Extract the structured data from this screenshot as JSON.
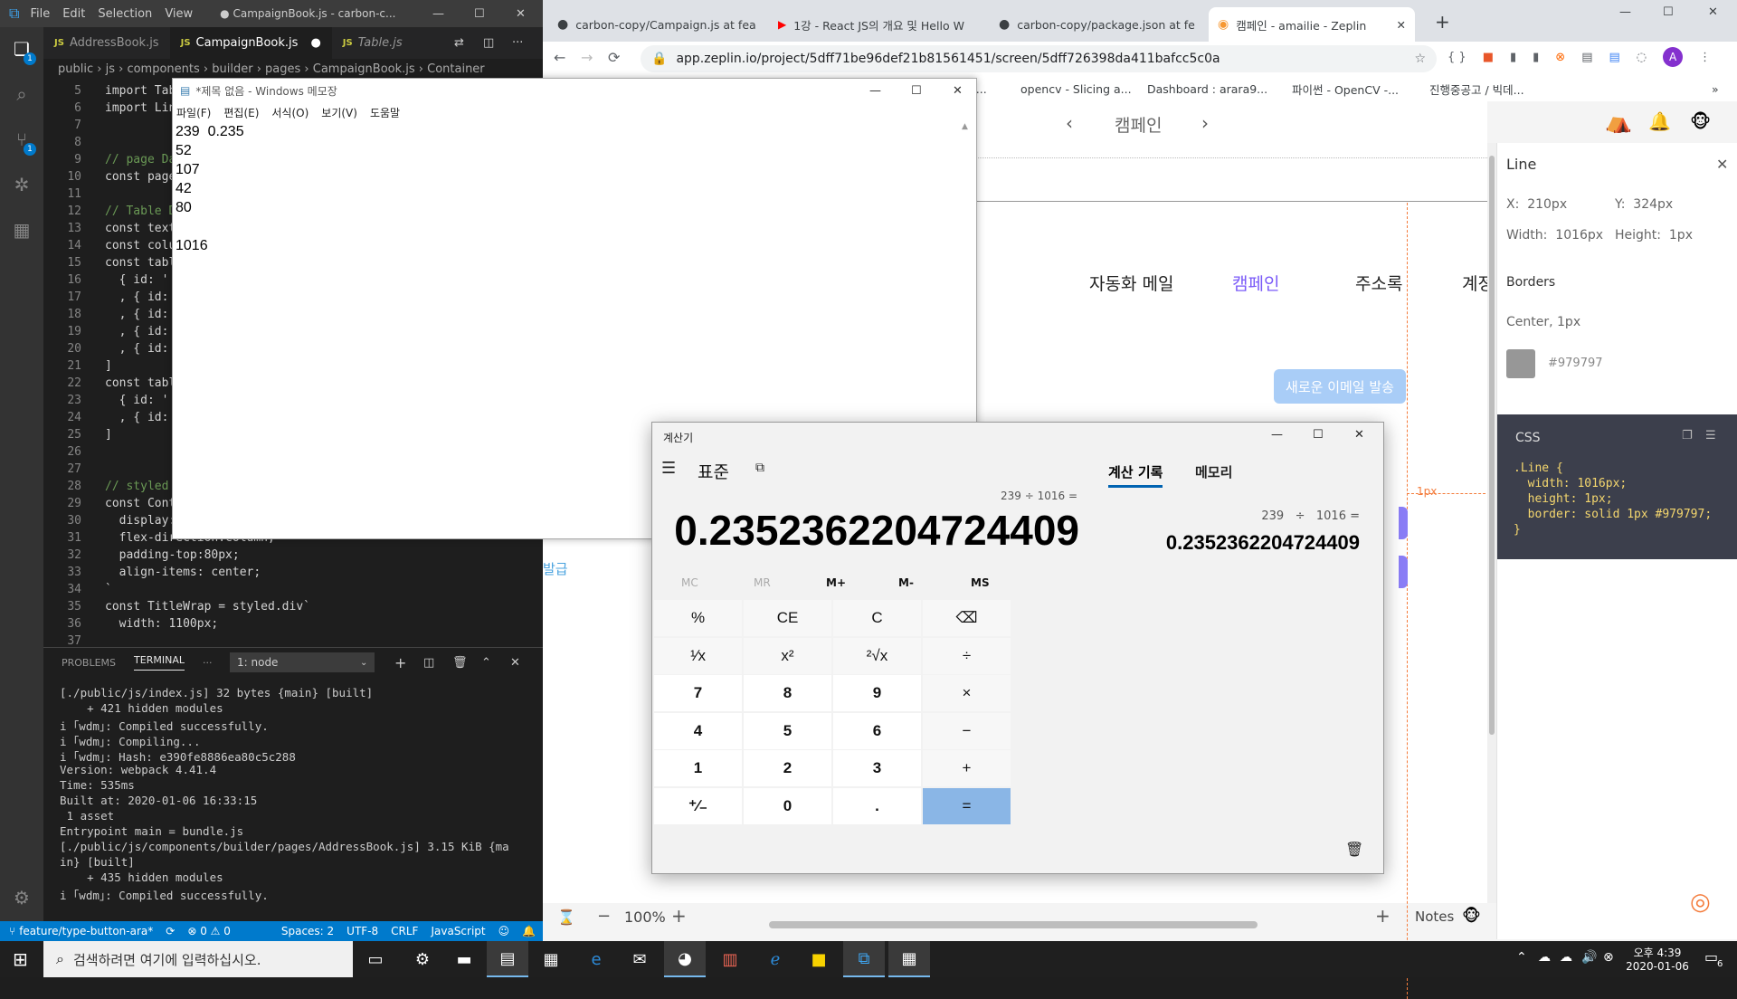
{
  "vscode": {
    "menu": [
      "File",
      "Edit",
      "Selection",
      "View"
    ],
    "title": "● CampaignBook.js - carbon-c...",
    "tabs": [
      {
        "label": "AddressBook.js",
        "badge": "JS",
        "italic": false,
        "active": false
      },
      {
        "label": "CampaignBook.js",
        "badge": "JS",
        "italic": false,
        "active": true,
        "dirty": "●"
      },
      {
        "label": "Table.js",
        "badge": "JS",
        "italic": true,
        "active": false
      }
    ],
    "breadcrumb": [
      "public",
      "js",
      "components",
      "builder",
      "pages",
      "CampaignBook.js",
      "Container"
    ],
    "lines": [
      {
        "n": "5",
        "t": "import Tab"
      },
      {
        "n": "6",
        "t": "import Lin"
      },
      {
        "n": "7",
        "t": ""
      },
      {
        "n": "8",
        "t": ""
      },
      {
        "n": "9",
        "t": "// page Da"
      },
      {
        "n": "10",
        "t": "const page"
      },
      {
        "n": "11",
        "t": ""
      },
      {
        "n": "12",
        "t": "// Table D"
      },
      {
        "n": "13",
        "t": "const text"
      },
      {
        "n": "14",
        "t": "const colu"
      },
      {
        "n": "15",
        "t": "const tabl"
      },
      {
        "n": "16",
        "t": "  { id: '"
      },
      {
        "n": "17",
        "t": "  , { id:"
      },
      {
        "n": "18",
        "t": "  , { id:"
      },
      {
        "n": "19",
        "t": "  , { id:"
      },
      {
        "n": "20",
        "t": "  , { id:"
      },
      {
        "n": "21",
        "t": "]"
      },
      {
        "n": "22",
        "t": "const tabl"
      },
      {
        "n": "23",
        "t": "  { id: '"
      },
      {
        "n": "24",
        "t": "  , { id:"
      },
      {
        "n": "25",
        "t": "]"
      },
      {
        "n": "26",
        "t": ""
      },
      {
        "n": "27",
        "t": ""
      },
      {
        "n": "28",
        "t": "// styled"
      },
      {
        "n": "29",
        "t": "const Cont"
      },
      {
        "n": "30",
        "t": "  display:"
      },
      {
        "n": "31",
        "t": "  flex-direction:column;"
      },
      {
        "n": "32",
        "t": "  padding-top:80px;"
      },
      {
        "n": "33",
        "t": "  align-items: center;"
      },
      {
        "n": "34",
        "t": "`"
      },
      {
        "n": "35",
        "t": "const TitleWrap = styled.div`"
      },
      {
        "n": "36",
        "t": "  width: 1100px;"
      },
      {
        "n": "37",
        "t": ""
      }
    ],
    "panel_tabs": [
      "PROBLEMS",
      "TERMINAL",
      "···"
    ],
    "terminal_select": "1: node",
    "terminal": [
      "[./public/js/index.js] 32 bytes {main} [built]",
      "    + 421 hidden modules",
      "i ｢wdm｣: Compiled successfully.",
      "i ｢wdm｣: Compiling...",
      "i ｢wdm｣: Hash: e390fe8886ea80c5c288",
      "Version: webpack 4.41.4",
      "Time: 535ms",
      "Built at: 2020-01-06 16:33:15",
      " 1 asset",
      "Entrypoint main = bundle.js",
      "[./public/js/components/builder/pages/AddressBook.js] 3.15 KiB {ma",
      "in} [built]",
      "    + 435 hidden modules",
      "i ｢wdm｣: Compiled successfully.",
      ""
    ],
    "status": {
      "branch": "feature/type-button-ara*",
      "errors": "⊗ 0 ⚠ 0",
      "spaces": "Spaces: 2",
      "encoding": "UTF-8",
      "eol": "CRLF",
      "language": "JavaScript"
    },
    "activity_badges": [
      "1",
      "1"
    ]
  },
  "notepad": {
    "title": "*제목 없음 - Windows 메모장",
    "menu": [
      "파일(F)",
      "편집(E)",
      "서식(O)",
      "보기(V)",
      "도움말"
    ],
    "lines": [
      "239\t0.235",
      "52",
      "107",
      "42",
      "80",
      "",
      "1016"
    ]
  },
  "chrome": {
    "tabs": [
      {
        "label": "carbon-copy/Campaign.js at fea",
        "icon": "github-icon"
      },
      {
        "label": "1강 - React JS의 개요 및 Hello W",
        "icon": "youtube-icon"
      },
      {
        "label": "carbon-copy/package.json at fe",
        "icon": "github-icon"
      },
      {
        "label": "캠페인 - amailie - Zeplin",
        "icon": "zeplin-icon",
        "active": true
      }
    ],
    "url": "app.zeplin.io/project/5dff71be96def21b81561451/screen/5dff726398da411bafcc5c0a",
    "bookmarks": [
      "ra...",
      "opencv - Slicing a...",
      "Dashboard : arara9...",
      "파이썬 - OpenCV -...",
      "진행중공고 / 빅데..."
    ],
    "profile": "A"
  },
  "zeplin": {
    "screen_title": "캠페인",
    "nav": [
      "자동화 메일",
      "캠페인",
      "주소록",
      "계정"
    ],
    "new_email_button": "새로운 이메일 발송",
    "left_link": "발급",
    "dim_label": "1px",
    "zoom": "100%",
    "notes": "Notes",
    "panel": {
      "title": "Line",
      "x": "X:  210px",
      "y": "Y:  324px",
      "width": "Width:  1016px",
      "height": "Height:  1px",
      "borders_label": "Borders",
      "border_desc": "Center, 1px",
      "border_color": "#979797",
      "css_label": "CSS",
      "css_lines": [
        ".Line {",
        "  width: 1016px;",
        "  height: 1px;",
        "  border: solid 1px #979797;",
        "}"
      ]
    },
    "accent": "#7a5af8"
  },
  "calculator": {
    "title": "계산기",
    "mode": "표준",
    "expression": "239 ÷ 1016 =",
    "display": "0.2352362204724409",
    "history_tab": "계산 기록",
    "memory_tab": "메모리",
    "history_expr": "239   ÷   1016 =",
    "history_result": "0.2352362204724409",
    "memory_keys": [
      "MC",
      "MR",
      "M+",
      "M-",
      "MS"
    ],
    "keys": [
      [
        "%",
        "CE",
        "C",
        "⌫"
      ],
      [
        "¹∕x",
        "x²",
        "²√x",
        "÷"
      ],
      [
        "7",
        "8",
        "9",
        "×"
      ],
      [
        "4",
        "5",
        "6",
        "−"
      ],
      [
        "1",
        "2",
        "3",
        "+"
      ],
      [
        "⁺∕₋",
        "0",
        ".",
        "="
      ]
    ]
  },
  "taskbar": {
    "search_placeholder": "검색하려면 여기에 입력하십시오.",
    "time": "오후 4:39",
    "date": "2020-01-06",
    "notification_count": "6"
  }
}
